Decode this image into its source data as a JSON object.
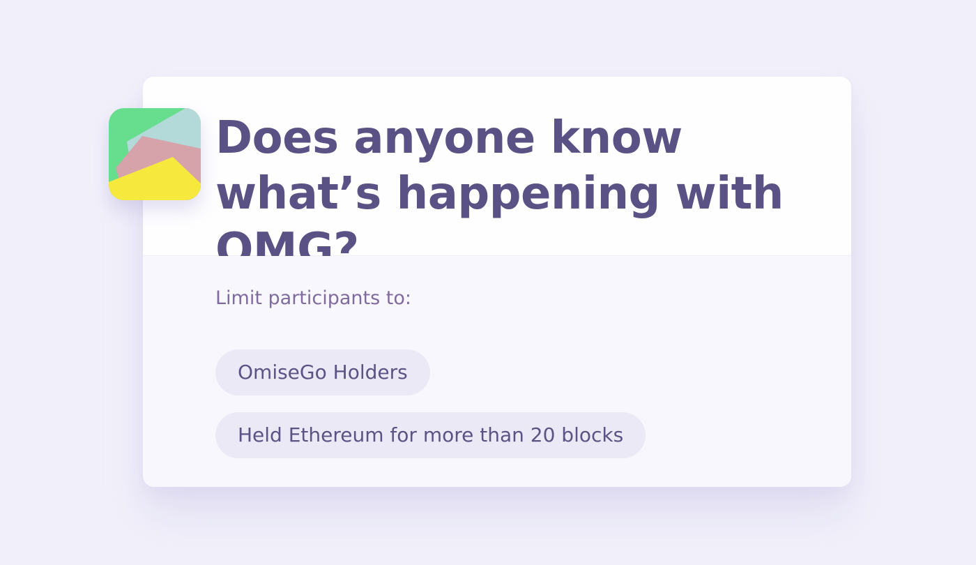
{
  "post": {
    "title": "Does anyone know what’s happening with OMG?",
    "icon": "token-cards-icon"
  },
  "restrictions": {
    "label": "Limit participants to:",
    "options": [
      {
        "label": "OmiseGo Holders"
      },
      {
        "label": "Held Ethereum for more than 20 blocks"
      }
    ]
  },
  "colors": {
    "background": "#f1f0fa",
    "title": "#5a5185",
    "label": "#7f6b9e",
    "pill_bg": "#ece9f7",
    "pill_text": "#5b5384",
    "icon_green": "#67dd8e",
    "icon_teal": "#b3d9d9",
    "icon_pink": "#d6a3ab",
    "icon_yellow": "#f6e83c"
  }
}
